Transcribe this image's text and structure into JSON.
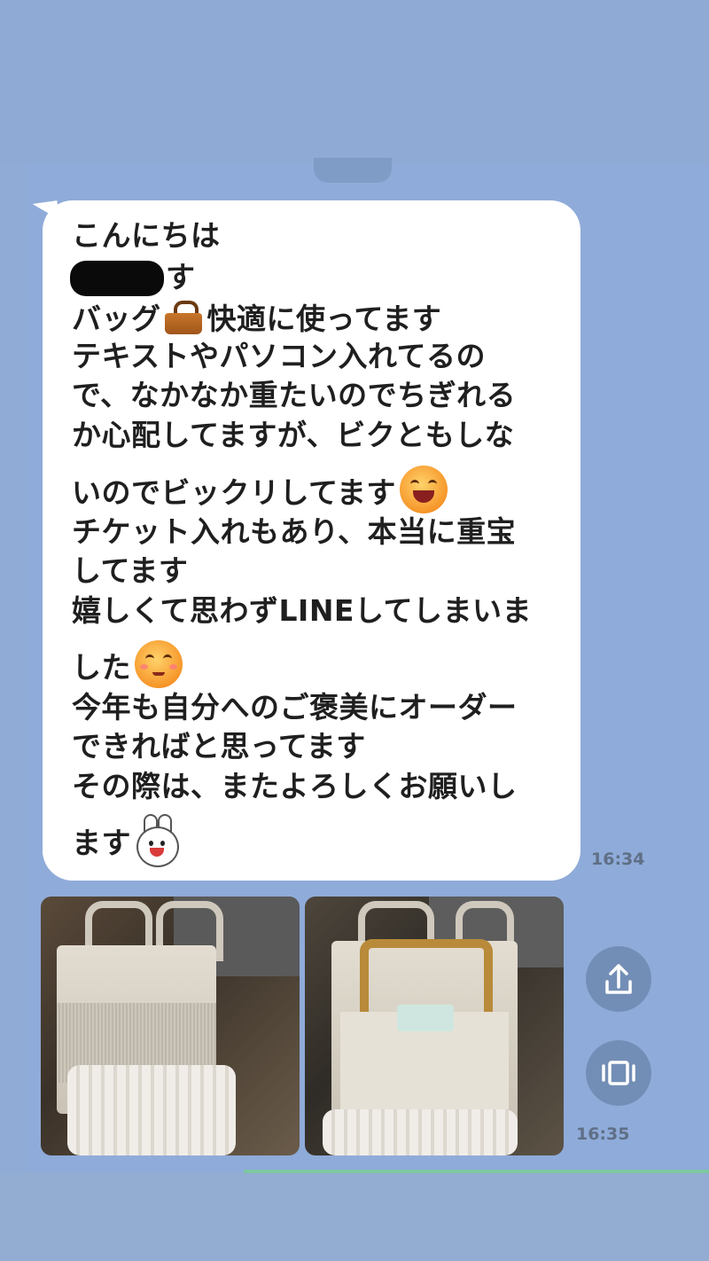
{
  "message": {
    "lines": [
      "こんにちは",
      "す",
      "バッグ",
      "快適に使ってます",
      "テキストやパソコン入れてるの",
      "で、なかなか重たいのでちぎれる",
      "か心配してますが、ビクともしな",
      "いのでビックリしてます",
      "チケット入れもあり、本当に重宝",
      "してます",
      "嬉しくて思わずLINEしてしまいま",
      "した",
      "今年も自分へのご褒美にオーダー",
      "できればと思ってます",
      "その際は、またよろしくお願いし",
      "ます"
    ],
    "timestamp": "16:34"
  },
  "photos": {
    "timestamp": "16:35"
  },
  "icons": {
    "bag": "handbag-emoji",
    "grin": "grinning-face-emoji",
    "blush": "blushing-face-emoji",
    "bunny": "line-cony-bunny-emoji",
    "share": "share-icon",
    "view": "view-all-icon"
  },
  "colors": {
    "chat_background": "#8fabd9",
    "bubble": "#ffffff",
    "text": "#1f1f1f",
    "timestamp": "#5f6f86"
  }
}
